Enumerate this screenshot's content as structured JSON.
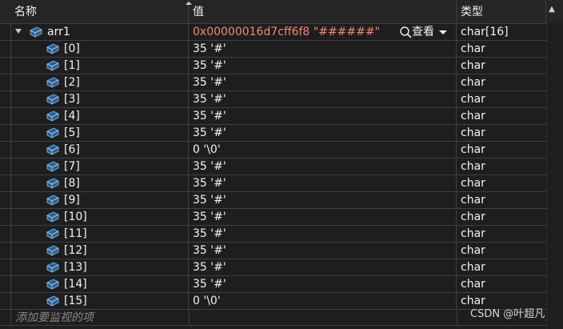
{
  "columns": {
    "name": "名称",
    "value": "值",
    "type": "类型"
  },
  "parent": {
    "name": "arr1",
    "value": "0x00000016d7cff6f8 \"######\"",
    "viewer_label": "查看",
    "type": "char[16]",
    "expanded": true
  },
  "rows": [
    {
      "name": "[0]",
      "value": "35 '#'",
      "type": "char"
    },
    {
      "name": "[1]",
      "value": "35 '#'",
      "type": "char"
    },
    {
      "name": "[2]",
      "value": "35 '#'",
      "type": "char"
    },
    {
      "name": "[3]",
      "value": "35 '#'",
      "type": "char"
    },
    {
      "name": "[4]",
      "value": "35 '#'",
      "type": "char"
    },
    {
      "name": "[5]",
      "value": "35 '#'",
      "type": "char"
    },
    {
      "name": "[6]",
      "value": "0 '\\0'",
      "type": "char"
    },
    {
      "name": "[7]",
      "value": "35 '#'",
      "type": "char"
    },
    {
      "name": "[8]",
      "value": "35 '#'",
      "type": "char"
    },
    {
      "name": "[9]",
      "value": "35 '#'",
      "type": "char"
    },
    {
      "name": "[10]",
      "value": "35 '#'",
      "type": "char"
    },
    {
      "name": "[11]",
      "value": "35 '#'",
      "type": "char"
    },
    {
      "name": "[12]",
      "value": "35 '#'",
      "type": "char"
    },
    {
      "name": "[13]",
      "value": "35 '#'",
      "type": "char"
    },
    {
      "name": "[14]",
      "value": "35 '#'",
      "type": "char"
    },
    {
      "name": "[15]",
      "value": "0 '\\0'",
      "type": "char"
    }
  ],
  "add_watch_placeholder": "添加要监视的项",
  "watermark": "CSDN @叶超凡",
  "icons": {
    "variable": "variable-cube-icon",
    "viewer": "magnifier-icon",
    "expander": "expand-triangle-icon"
  },
  "colors": {
    "background": "#1e1e1e",
    "header": "#252526",
    "grid_line": "#3f3f46",
    "pointer_value": "#f48771",
    "icon_blue": "#6ea8dc"
  }
}
